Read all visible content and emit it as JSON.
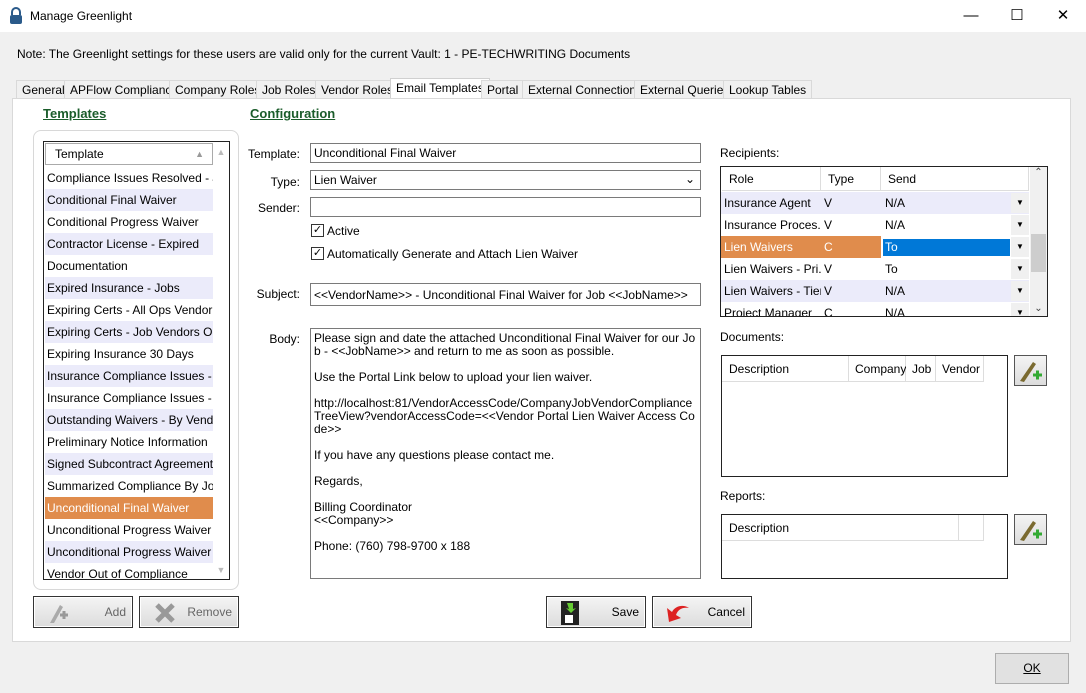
{
  "window": {
    "title": "Manage Greenlight",
    "minimize": "—",
    "maximize": "☐",
    "close": "✕"
  },
  "note": "Note:  The Greenlight settings for these users are valid only for the current Vault: 1 - PE-TECHWRITING Documents",
  "tabs": [
    {
      "label": "General"
    },
    {
      "label": "APFlow Compliance"
    },
    {
      "label": "Company Roles"
    },
    {
      "label": "Job Roles"
    },
    {
      "label": "Vendor Roles"
    },
    {
      "label": "Email Templates",
      "selected": true
    },
    {
      "label": "Portal"
    },
    {
      "label": "External Connections"
    },
    {
      "label": "External Queries"
    },
    {
      "label": "Lookup Tables"
    }
  ],
  "templates": {
    "heading": "Templates",
    "column": "Template",
    "selected": "Unconditional Final Waiver",
    "items": [
      "Compliance Issues Resolved - J...",
      "Conditional Final Waiver",
      "Conditional Progress Waiver",
      "Contractor License - Expired",
      "Documentation",
      "Expired Insurance - Jobs",
      "Expiring Certs - All Ops Vendor",
      "Expiring Certs - Job Vendors Only",
      "Expiring Insurance 30 Days",
      "Insurance Compliance Issues - ...",
      "Insurance Compliance Issues - ...",
      "Outstanding Waivers - By Vend...",
      "Preliminary Notice Information",
      "Signed Subcontract Agreement",
      "Summarized Compliance By Job",
      "Unconditional Final Waiver",
      "Unconditional Progress Waiver",
      "Unconditional Progress Waiver ...",
      "Vendor Out of Compliance"
    ],
    "add": "Add",
    "remove": "Remove"
  },
  "config": {
    "heading": "Configuration",
    "template_label": "Template:",
    "template": "Unconditional Final Waiver",
    "type_label": "Type:",
    "type": "Lien Waiver",
    "sender_label": "Sender:",
    "sender": "",
    "active_label": "Active",
    "active": true,
    "auto_label": "Automatically Generate and Attach Lien Waiver",
    "auto": true,
    "subject_label": "Subject:",
    "subject": "<<VendorName>> - Unconditional Final Waiver for Job <<JobName>>",
    "body_label": "Body:",
    "body": "Please sign and date the attached Unconditional Final Waiver for our Job - <<JobName>> and return to me as soon as possible.\n\nUse the Portal Link below to upload your lien waiver.\n\nhttp://localhost:81/VendorAccessCode/CompanyJobVendorComplianceTreeView?vendorAccessCode=<<Vendor Portal Lien Waiver Access Code>>\n\nIf you have any questions please contact me.\n\nRegards,\n\nBilling Coordinator\n<<Company>>\n\nPhone: (760) 798-9700 x 188",
    "save": "Save",
    "cancel": "Cancel"
  },
  "recipients": {
    "label": "Recipients:",
    "columns": [
      "Role",
      "Type",
      "Send"
    ],
    "rows": [
      {
        "role": "Insurance Agent",
        "type": "V",
        "send": "N/A"
      },
      {
        "role": "Insurance Proces...",
        "type": "V",
        "send": "N/A"
      },
      {
        "role": "Lien Waivers",
        "type": "C",
        "send": "To",
        "selected": true
      },
      {
        "role": "Lien Waivers - Pri...",
        "type": "V",
        "send": "To"
      },
      {
        "role": "Lien Waivers - Tier",
        "type": "V",
        "send": "N/A"
      },
      {
        "role": "Project Manager",
        "type": "C",
        "send": "N/A"
      }
    ]
  },
  "documents": {
    "label": "Documents:",
    "columns": [
      "Description",
      "Company",
      "Job",
      "Vendor"
    ]
  },
  "reports": {
    "label": "Reports:",
    "columns": [
      "Description"
    ]
  },
  "ok": "OK",
  "colors": {
    "selection": "#e08c4c",
    "heading": "#1a5c2a",
    "alt_row": "#ebebfa",
    "cell_edit": "#0078d7"
  }
}
